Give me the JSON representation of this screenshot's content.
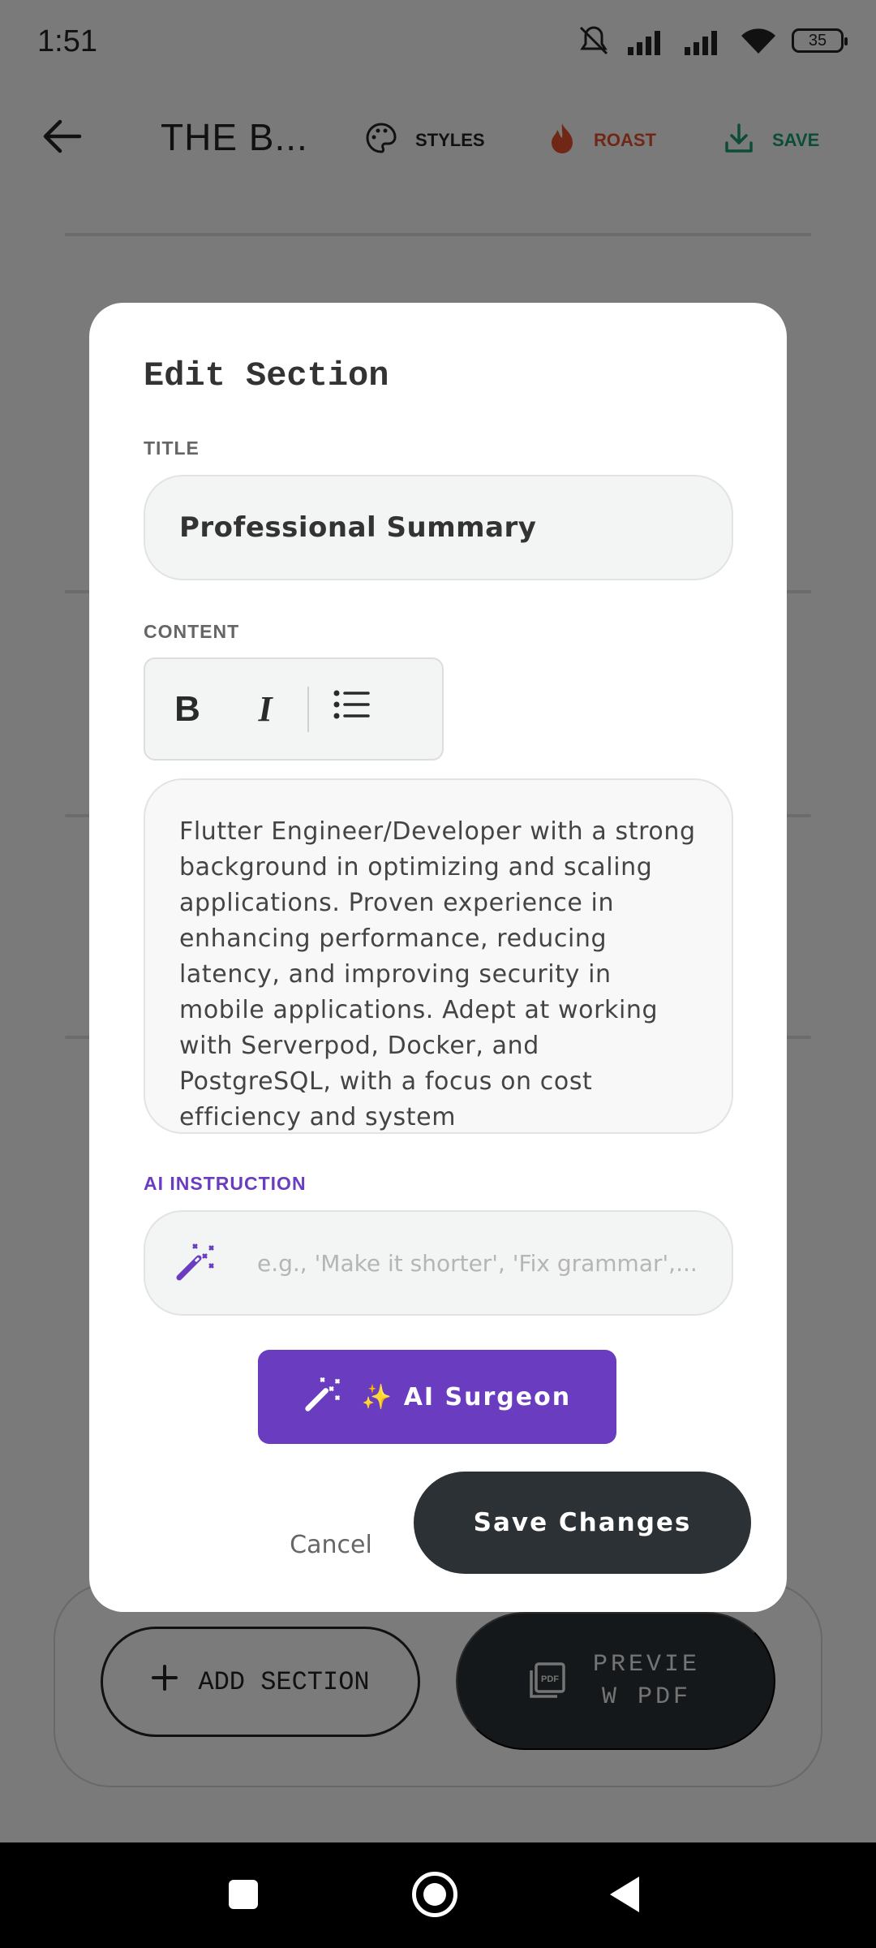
{
  "status_bar": {
    "time": "1:51",
    "battery": "35"
  },
  "app_bar": {
    "title": "THE B...",
    "actions": {
      "styles": "STYLES",
      "roast": "ROAST",
      "save": "SAVE"
    }
  },
  "footer": {
    "add_section": "ADD SECTION",
    "preview_pdf": "PREVIEW PDF"
  },
  "dialog": {
    "title": "Edit Section",
    "title_label": "TITLE",
    "title_value": "Professional Summary",
    "content_label": "CONTENT",
    "toolbar": {
      "bold": "B",
      "italic": "I"
    },
    "content_value": "Flutter Engineer/Developer with a strong background in optimizing and scaling applications. Proven experience in enhancing performance, reducing latency, and improving security in mobile applications. Adept at working with Serverpod, Docker, and PostgreSQL, with a focus on cost efficiency and system",
    "ai_label": "AI INSTRUCTION",
    "ai_placeholder": "e.g., 'Make it shorter', 'Fix grammar',...",
    "ai_button": "✨ AI Surgeon",
    "cancel": "Cancel",
    "save": "Save Changes"
  },
  "colors": {
    "accent_purple": "#6a3dc0",
    "dark_button": "#2b3134",
    "roast_orange": "#e04e2a",
    "save_green": "#1b9a6c"
  }
}
